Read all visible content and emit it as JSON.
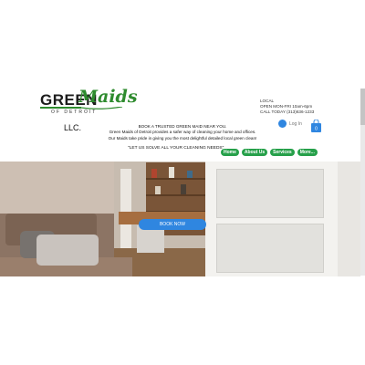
{
  "brand": {
    "logo_word": "GREEN",
    "logo_script": "Maids",
    "logo_sub": "OF DETROIT",
    "suffix": "LLC."
  },
  "intro": {
    "line1": "BOOK A TRUSTED GREEN MAID NEAR YOU.",
    "line2": "Green Maids of Detroit provides a safer way of cleaning your home and offices.",
    "line3": "Our Maids take pride in giving you the most delightful detailed local green clean!",
    "motto": "\"LET US SOLVE ALL YOUR CLEANING NEEDS\""
  },
  "contact": {
    "line1": "LOCAL",
    "line2": "OPEN MON-FRI 10am-6pm",
    "line3": "CALL TODAY (313)636-1233"
  },
  "account": {
    "login_label": "Log In",
    "cart_count": "0"
  },
  "nav": {
    "items": [
      "Home",
      "About Us",
      "Services",
      "More..."
    ]
  },
  "hero": {
    "cta_label": "BOOK NOW"
  },
  "colors": {
    "brand_green": "#26a04a",
    "accent_blue": "#2f86e0"
  }
}
